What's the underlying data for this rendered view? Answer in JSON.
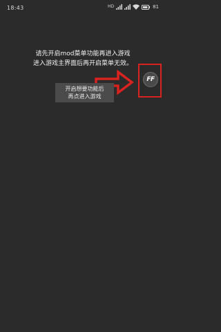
{
  "status_bar": {
    "time": "18:43",
    "sim_label": "HD",
    "battery_level": "81",
    "icons": [
      "sim-hd-icon",
      "signal-icon",
      "signal-icon",
      "wifi-icon",
      "battery-icon"
    ]
  },
  "instruction": {
    "line1": "请先开启mod菜单功能再进入游戏",
    "line2": "进入游戏主界面后再开启菜单无效。"
  },
  "floating_button": {
    "label": "FF"
  },
  "toast": {
    "line1": "开启想要功能后",
    "line2": "再点进入游戏"
  },
  "colors": {
    "background": "#2b2b2b",
    "annotation_red": "#d8231f",
    "toast_background": "#4b4b4b"
  }
}
